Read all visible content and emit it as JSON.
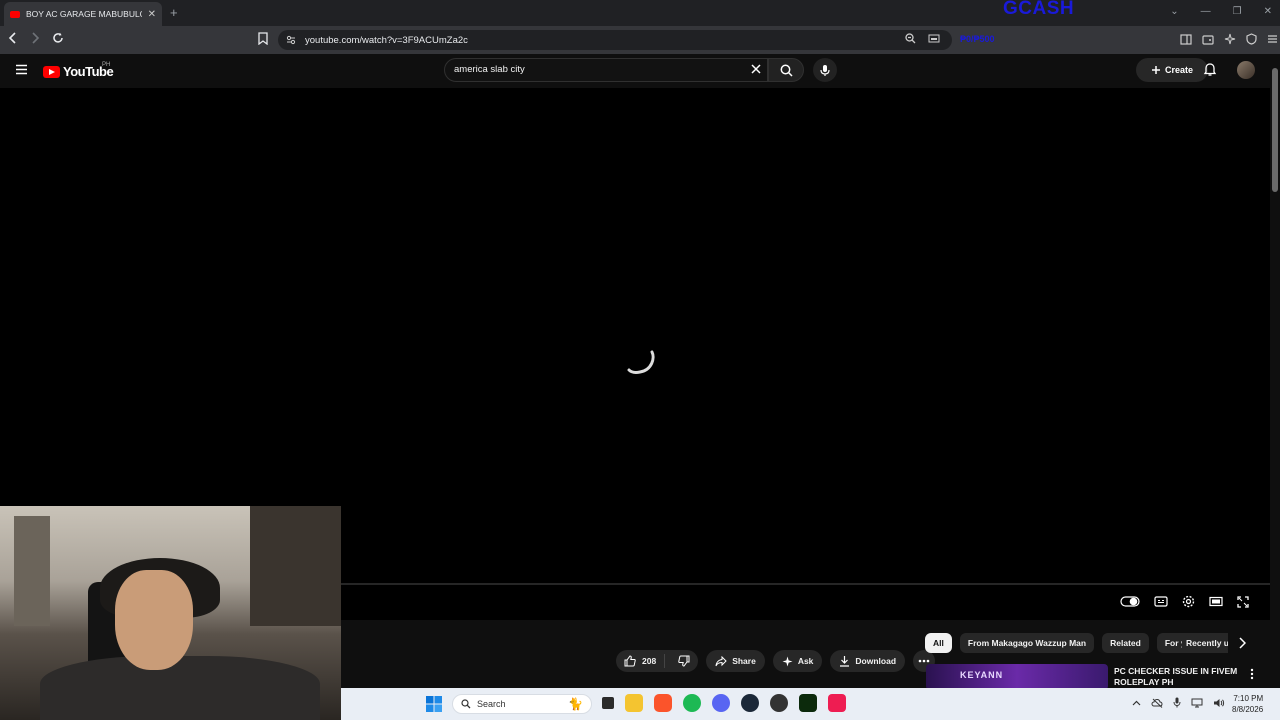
{
  "browser": {
    "tab_title": "BOY AC GARAGE MABUBULOK",
    "tab_close": "✕",
    "new_tab": "+",
    "url": "youtube.com/watch?v=3F9ACUmZa2c",
    "overlay_gcash": "GCASH",
    "overlay_donation": "₱0/₱500"
  },
  "youtube": {
    "logo_text": "YouTube",
    "region": "PH",
    "search_value": "america slab city",
    "create_label": "Create",
    "like_count": "208",
    "share_label": "Share",
    "ask_label": "Ask",
    "download_label": "Download",
    "chips": [
      {
        "label": "All"
      },
      {
        "label": "From Makagago Wazzup Man"
      },
      {
        "label": "Related"
      },
      {
        "label": "For you"
      },
      {
        "label": "Recently uploaded"
      }
    ],
    "recommended": {
      "title": "PC CHECKER ISSUE IN FIVEM ROLEPLAY PH",
      "thumb_text": "KEYANN"
    }
  },
  "taskbar": {
    "search_placeholder": "Search",
    "time": "7:10 PM",
    "date": "8/8/2026"
  },
  "colors": {
    "youtube_red": "#ff0000",
    "overlay_blue": "#1a1ad9",
    "page_bg": "#0f0f0f"
  }
}
